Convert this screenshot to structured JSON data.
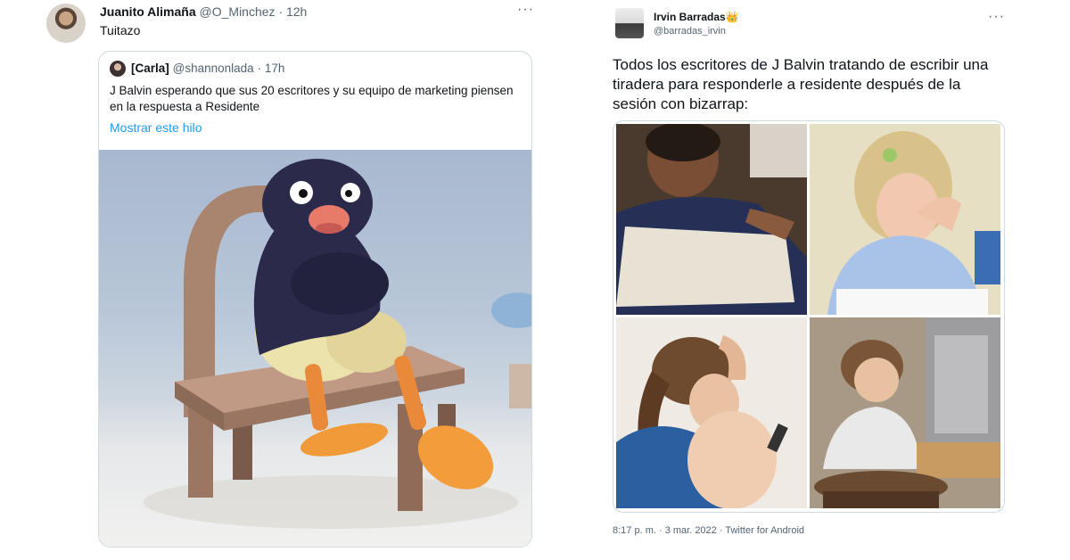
{
  "left_tweet": {
    "author_name": "Juanito Alimaña",
    "author_handle": "@O_Minchez",
    "time": "· 12h",
    "text": "Tuitazo",
    "more": "···",
    "quote": {
      "author_name": "[Carla]",
      "author_handle": "@shannonlada",
      "time": "· 17h",
      "text": "J Balvin esperando que sus 20 escritores y su equipo de marketing piensen en la respuesta a Residente",
      "show_thread": "Mostrar este hilo"
    }
  },
  "right_tweet": {
    "author_name": "Irvin Barradas",
    "author_badge": "👑",
    "author_handle": "@barradas_irvin",
    "more": "···",
    "text": "Todos los escritores de J Balvin tratando de escribir una tiradera para responderle a residente después de la sesión con bizarrap:",
    "timestamp": "8:17 p. m. · 3 mar. 2022 · Twitter for Android"
  },
  "colors": {
    "link": "#1d9bf0",
    "secondary_text": "#536471",
    "border": "#cfd9de"
  }
}
